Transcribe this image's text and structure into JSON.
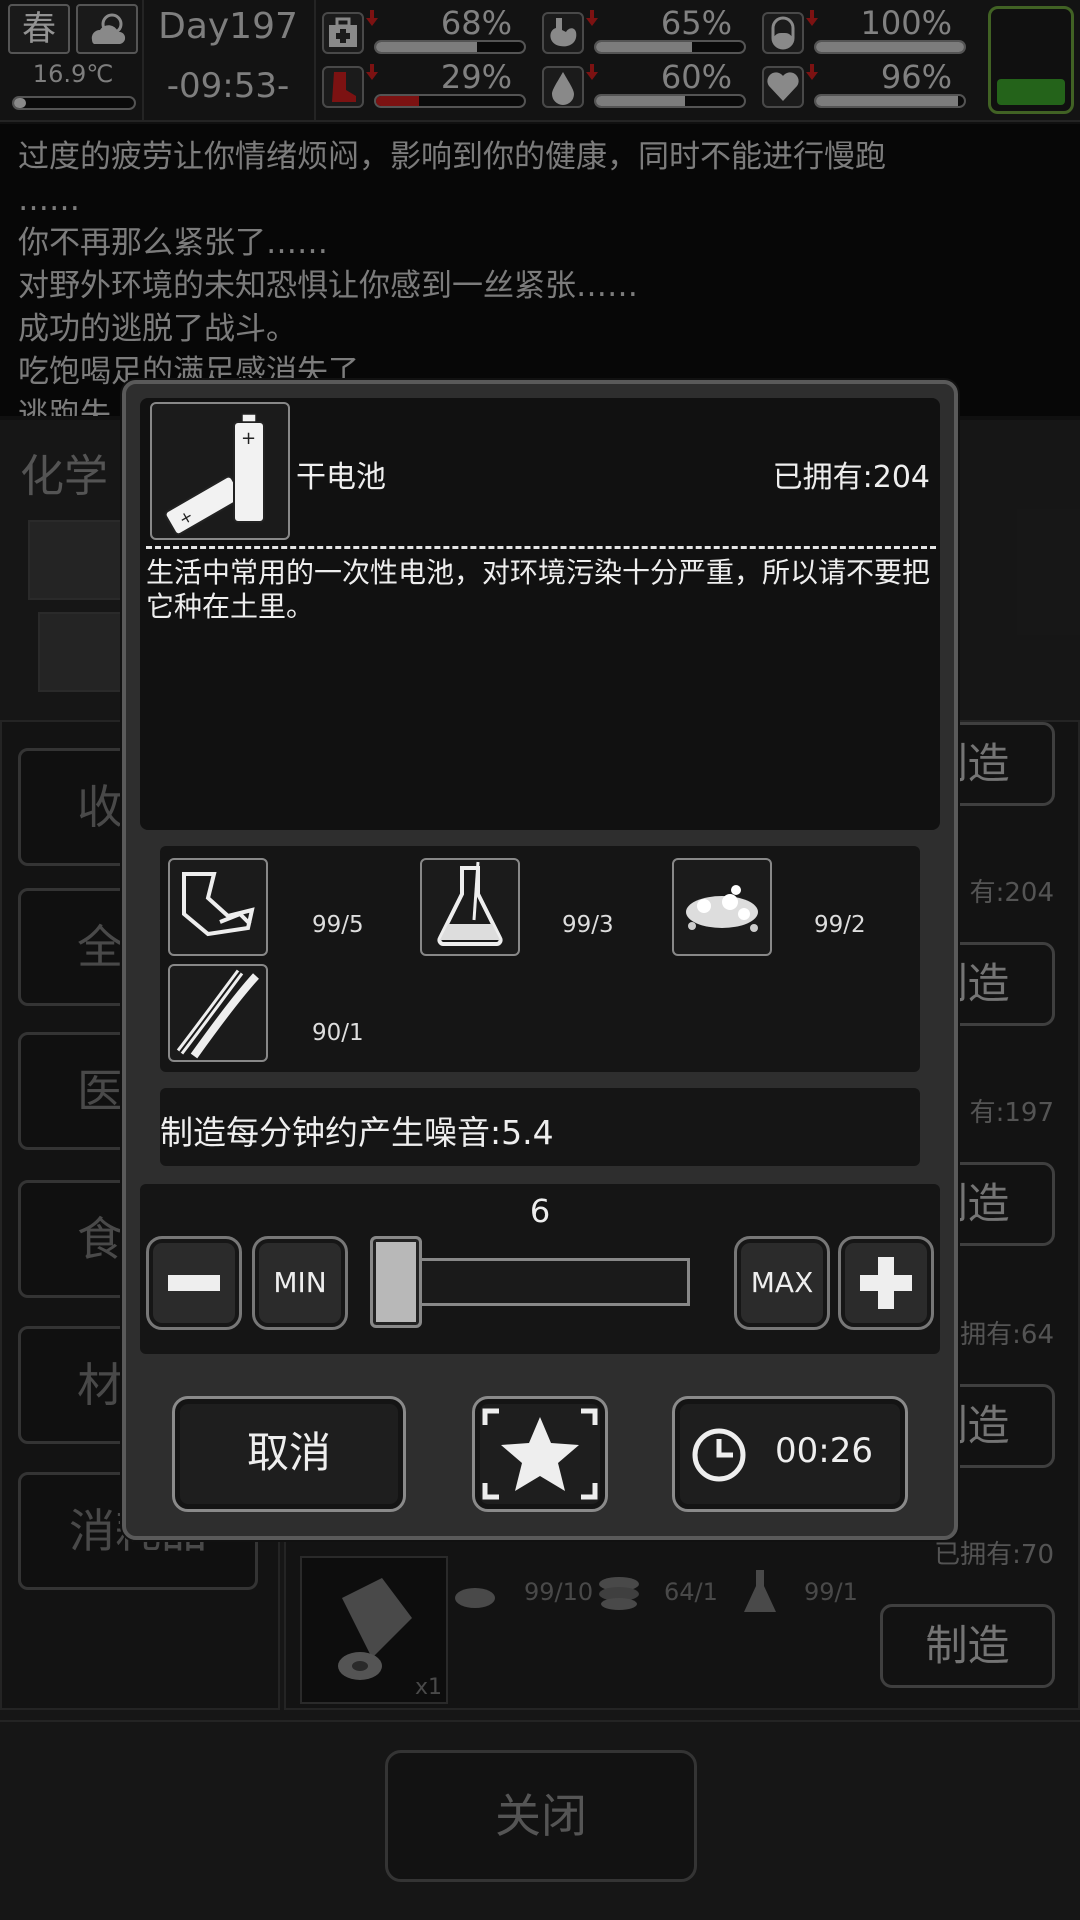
{
  "status": {
    "season": "春",
    "temperature": "16.9℃",
    "day": "Day197",
    "time": "-09:53-",
    "stats": [
      {
        "icon": "medkit-icon",
        "value": "68%",
        "level": 0.68
      },
      {
        "icon": "stomach-icon",
        "value": "65%",
        "level": 0.65
      },
      {
        "icon": "pill-icon",
        "value": "100%",
        "level": 1.0
      },
      {
        "icon": "boot-icon",
        "value": "29%",
        "level": 0.29
      },
      {
        "icon": "water-drop-icon",
        "value": "60%",
        "level": 0.6
      },
      {
        "icon": "heart-icon",
        "value": "96%",
        "level": 0.96
      }
    ],
    "accent_red": "#c81e1e",
    "battery_color": "#3aa02a"
  },
  "log": {
    "lines": [
      "过度的疲劳让你情绪烦闷，影响到你的健康，同时不能进行慢跑",
      "……",
      "你不再那么紧张了……",
      "对野外环境的未知恐惧让你感到一丝紧张……",
      "成功的逃脱了战斗。",
      "吃饱喝足的满足感消失了",
      "逃跑失"
    ]
  },
  "background": {
    "category_title": "化学",
    "tabs": [
      "收",
      "全",
      "医",
      "食",
      "材",
      "消耗品"
    ],
    "make_label": "制造",
    "owned": [
      "有:204",
      "有:197",
      "拥有:64",
      "已拥有:70"
    ],
    "last_recipe": {
      "materials": [
        "99/10",
        "64/1",
        "99/1"
      ],
      "count": "x1"
    },
    "close_label": "关闭"
  },
  "modal": {
    "item_name": "干电池",
    "owned": "已拥有:204",
    "description": "生活中常用的一次性电池，对环境污染十分严重，所以请不要把它种在土里。",
    "materials": [
      {
        "icon": "scrap-metal-icon",
        "qty": "99/5"
      },
      {
        "icon": "flask-icon",
        "qty": "99/3"
      },
      {
        "icon": "powder-pile-icon",
        "qty": "99/2"
      },
      {
        "icon": "wire-icon",
        "qty": "90/1"
      }
    ],
    "noise": "制造每分钟约产生噪音:5.4",
    "quantity": "6",
    "slider_level": 0.0,
    "min_label": "MIN",
    "max_label": "MAX",
    "cancel_label": "取消",
    "craft_time": "00:26"
  }
}
